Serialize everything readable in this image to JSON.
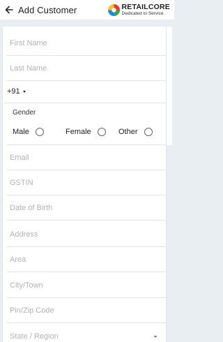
{
  "header": {
    "title": "Add Customer",
    "brand_name": "RETAILCORE",
    "brand_tagline": "Dedicated to Service"
  },
  "form": {
    "first_name_placeholder": "First Name",
    "last_name_placeholder": "Last Name",
    "country_code": "+91",
    "gender_label": "Gender",
    "gender_options": [
      "Male",
      "Female",
      "Other"
    ],
    "email_placeholder": "Email",
    "gstin_placeholder": "GSTIN",
    "dob_placeholder": "Date of Birth",
    "address_placeholder": "Address",
    "area_placeholder": "Area",
    "city_placeholder": "City/Town",
    "pin_placeholder": "Pin/Zip Code",
    "state_placeholder": "State / Region"
  },
  "colors": {
    "background": "#e9eef3",
    "placeholder": "#b3b3b3",
    "divider": "#e3e3e3"
  }
}
